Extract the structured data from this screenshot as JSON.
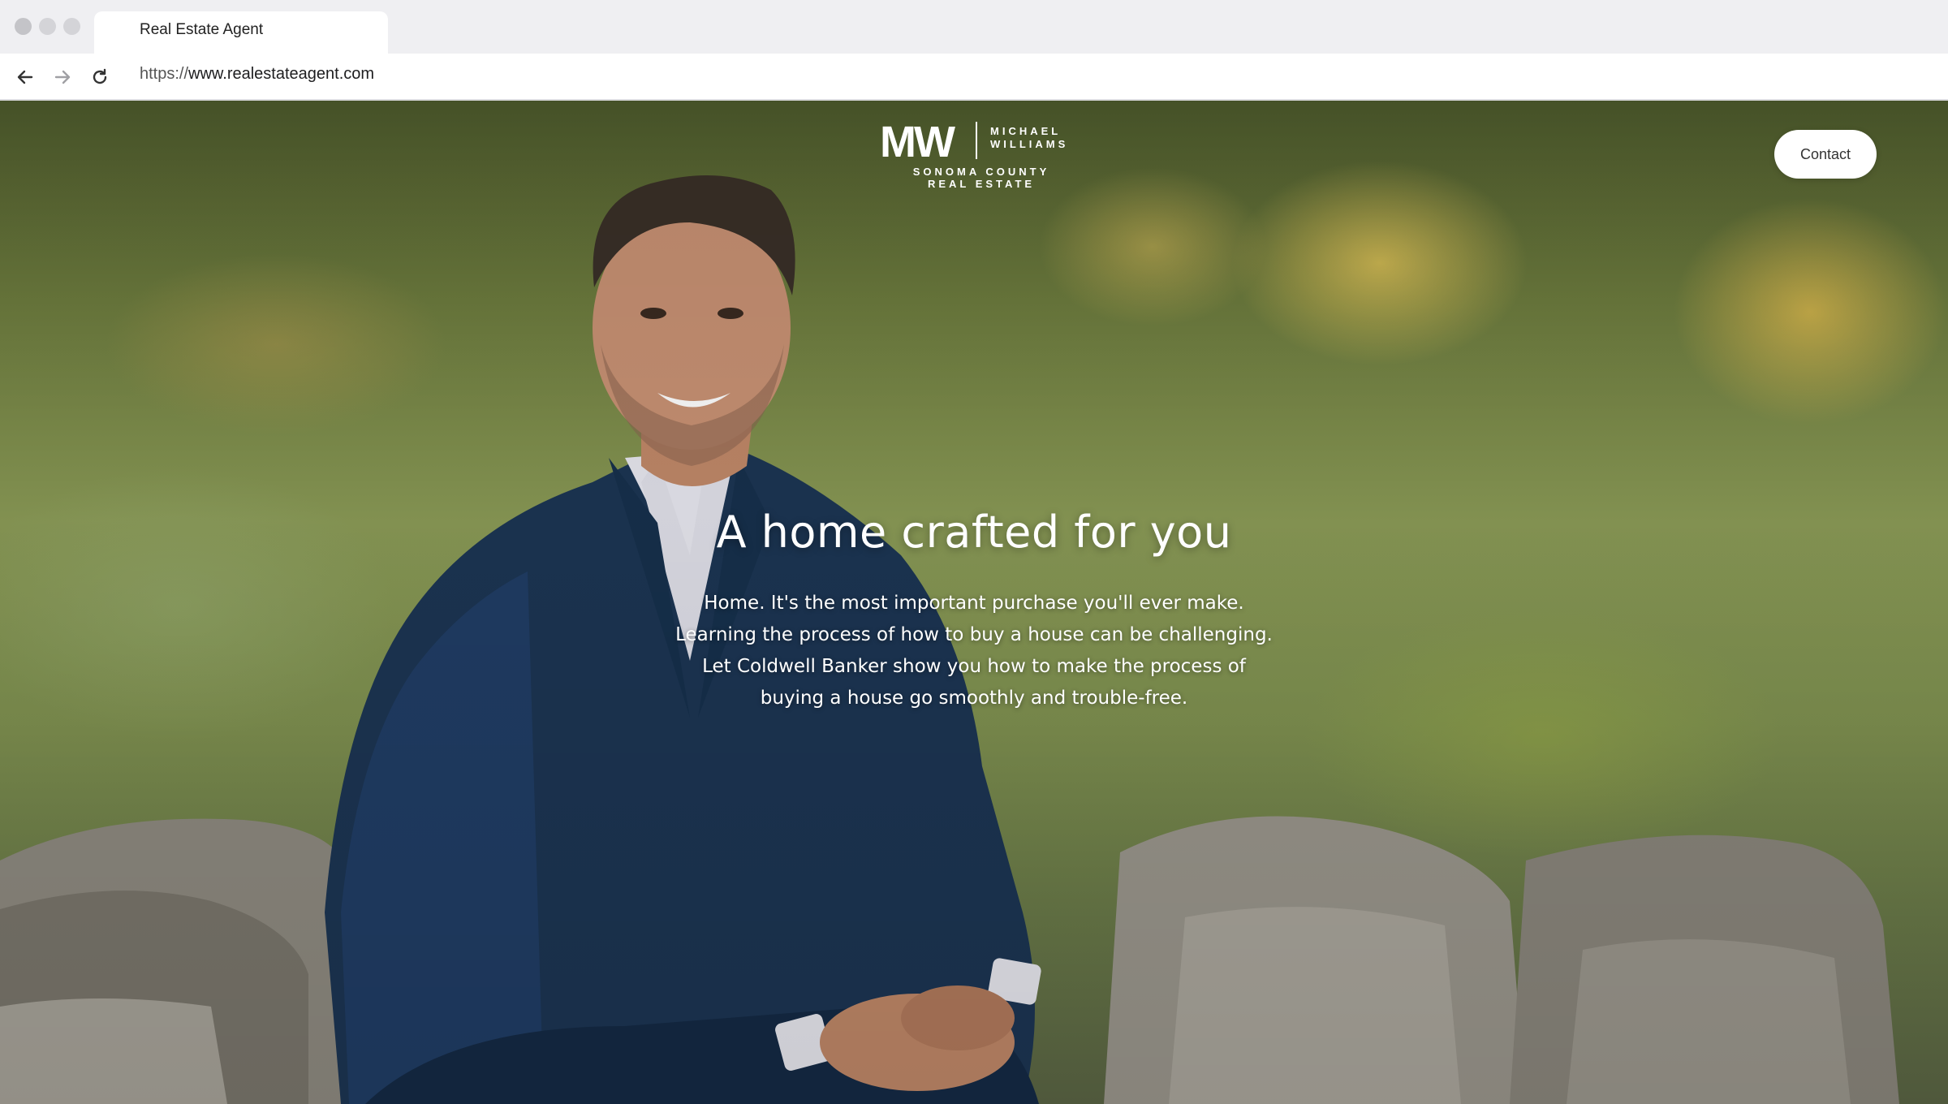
{
  "browser": {
    "tab_title": "Real Estate Agent",
    "url_protocol": "https://",
    "url_host": "www.realestateagent.com"
  },
  "logo": {
    "monogram": "MW",
    "name_line1": "MICHAEL",
    "name_line2": "WILLIAMS",
    "sub_line1": "SONOMA COUNTY",
    "sub_line2": "REAL ESTATE"
  },
  "nav": {
    "contact_label": "Contact"
  },
  "hero": {
    "headline": "A home crafted for you",
    "body_lines": [
      "Home. It's the most important purchase you'll ever make.",
      "Learning the process of how to buy a house can be challenging.",
      "Let Coldwell Banker show you how to make the process of",
      "buying a house go smoothly and trouble-free."
    ]
  },
  "colors": {
    "suit": "#1c3553",
    "accent_white": "#ffffff",
    "chrome_bg": "#efeff2"
  }
}
